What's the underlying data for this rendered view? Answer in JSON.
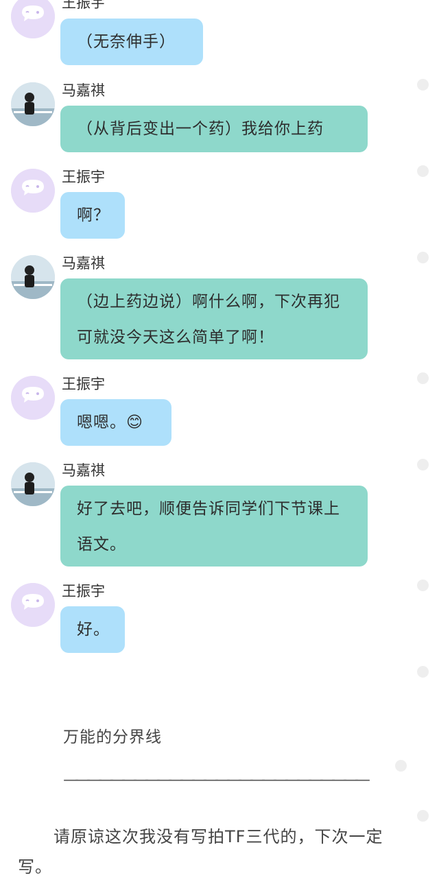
{
  "messages": [
    {
      "sender": "王振宇",
      "text": "（无奈伸手）"
    },
    {
      "sender": "马嘉祺",
      "text": "（从背后变出一个药）我给你上药"
    },
    {
      "sender": "王振宇",
      "text": "啊？"
    },
    {
      "sender": "马嘉祺",
      "text": "（边上药边说）啊什么啊，下次再犯可就没今天这么简单了啊！"
    },
    {
      "sender": "王振宇",
      "text": "嗯嗯。😊"
    },
    {
      "sender": "马嘉祺",
      "text": "好了去吧，顺便告诉同学们下节课上语文。"
    },
    {
      "sender": "王振宇",
      "text": "好。"
    }
  ],
  "divider": {
    "title": "万能的分界线",
    "line": "——————————————————————————"
  },
  "note": {
    "text": "请原谅这次我没有写拍TF三代的，下次一定写。"
  },
  "colors": {
    "bubble_blue": "#aee0fb",
    "bubble_teal": "#8ed8cb",
    "avatar_purple": "#e7dcf8"
  }
}
